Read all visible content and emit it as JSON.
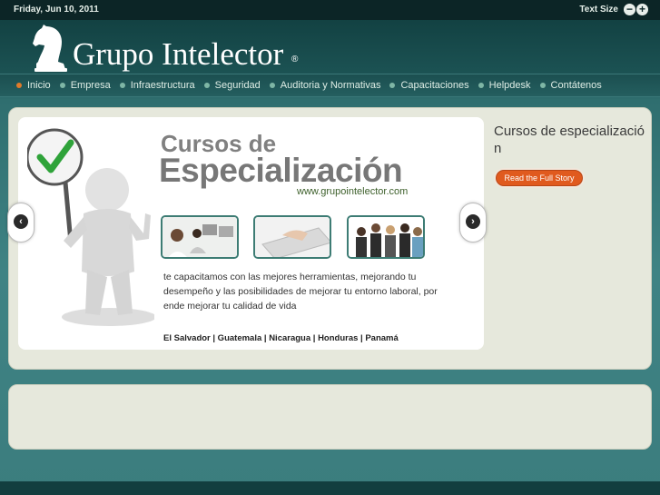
{
  "topbar": {
    "date": "Friday, Jun 10, 2011",
    "text_size_label": "Text Size",
    "decrease_icon": "minus-circle-icon",
    "increase_icon": "plus-circle-icon"
  },
  "logo": {
    "name": "Grupo Intelector",
    "reg": "®",
    "icon": "chess-knight-icon"
  },
  "nav": {
    "items": [
      {
        "label": "Inicio",
        "active": true
      },
      {
        "label": "Empresa"
      },
      {
        "label": "Infraestructura"
      },
      {
        "label": "Seguridad"
      },
      {
        "label": "Auditoria y Normativas"
      },
      {
        "label": "Capacitaciones"
      },
      {
        "label": "Helpdesk"
      },
      {
        "label": "Contátenos"
      }
    ]
  },
  "slide": {
    "title_line1": "Cursos de",
    "title_line2": "Especialización",
    "url": "www.grupointelector.com",
    "description": "te capacitamos con las mejores herramientas, mejorando tu desempeño y las posibilidades de mejorar tu entorno laboral, por ende mejorar tu calidad de vida",
    "countries": "El Salvador | Guatemala | Nicaragua | Honduras | Panamá",
    "prev_icon": "chevron-left-icon",
    "next_icon": "chevron-right-icon"
  },
  "feature": {
    "title": "Cursos de especialización",
    "button_label": "Read the Full Story"
  },
  "colors": {
    "accent": "#e05a1e",
    "header": "#0c2526",
    "panel": "#e6e8dc",
    "teal": "#3d7c74"
  }
}
